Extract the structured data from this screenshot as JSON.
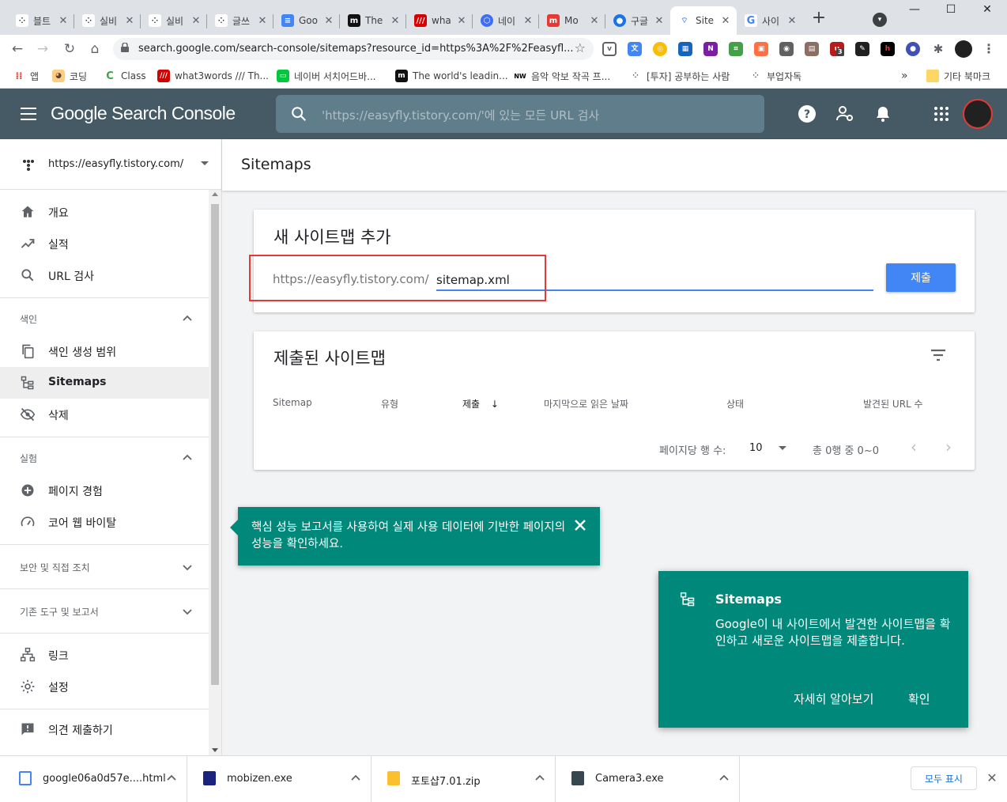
{
  "browser": {
    "tabs": [
      {
        "title": "블트",
        "active": false
      },
      {
        "title": "실비",
        "active": false
      },
      {
        "title": "실비",
        "active": false
      },
      {
        "title": "글쓰",
        "active": false
      },
      {
        "title": "Goo",
        "active": false
      },
      {
        "title": "The",
        "active": false
      },
      {
        "title": "wha",
        "active": false
      },
      {
        "title": "네이",
        "active": false
      },
      {
        "title": "Mo",
        "active": false
      },
      {
        "title": "구글",
        "active": false
      },
      {
        "title": "Site",
        "active": true
      },
      {
        "title": "사이",
        "active": false
      }
    ],
    "new_tab_symbol": "+",
    "url": "search.google.com/search-console/sitemaps?resource_id=https%3A%2F%2Feasyfl...",
    "ext_badge": "3",
    "bookmarks": [
      {
        "label": "앱"
      },
      {
        "label": "코딩"
      },
      {
        "label": "Class"
      },
      {
        "label": "what3words /// Th..."
      },
      {
        "label": "네이버 서치어드바..."
      },
      {
        "label": "The world's leadin..."
      },
      {
        "label": "음악 악보 작곡 프..."
      },
      {
        "label": "[투자] 공부하는 사람"
      },
      {
        "label": "부업자독"
      }
    ],
    "bookmarks_more": "»",
    "other_bookmarks": "기타 북마크"
  },
  "gsc": {
    "brand": "Google Search Console",
    "search_placeholder": "'https://easyfly.tistory.com/'에 있는 모든 URL 검사",
    "property": "https://easyfly.tistory.com/",
    "nav_top": [
      {
        "label": "개요",
        "icon": "home-icon"
      },
      {
        "label": "실적",
        "icon": "trending-up-icon"
      },
      {
        "label": "URL 검사",
        "icon": "search-icon"
      }
    ],
    "section_index": "색인",
    "nav_index": [
      {
        "label": "색인 생성 범위",
        "icon": "copy-icon"
      },
      {
        "label": "Sitemaps",
        "icon": "sitemap-icon"
      },
      {
        "label": "삭제",
        "icon": "visibility-off-icon"
      }
    ],
    "section_experience": "실험",
    "nav_experience": [
      {
        "label": "페이지 경험",
        "icon": "add-circle-icon"
      },
      {
        "label": "코어 웹 바이탈",
        "icon": "speed-icon"
      }
    ],
    "section_security": "보안 및 직접 조치",
    "section_legacy": "기존 도구 및 보고서",
    "nav_bottom": [
      {
        "label": "링크",
        "icon": "links-icon"
      },
      {
        "label": "설정",
        "icon": "settings-icon"
      }
    ],
    "feedback": "의견 제출하기"
  },
  "main": {
    "page_title": "Sitemaps",
    "add_card": {
      "title": "새 사이트맵 추가",
      "prefix": "https://easyfly.tistory.com/",
      "input_value": "sitemap.xml",
      "submit_label": "제출"
    },
    "submitted_card": {
      "title": "제출된 사이트맵",
      "columns": [
        "Sitemap",
        "유형",
        "제출",
        "마지막으로 읽은 날짜",
        "상태",
        "발견된 URL 수"
      ],
      "sort_arrow": "↓",
      "rows_per_page_label": "페이지당 행 수:",
      "rows_per_page_value": "10",
      "range_text": "총 0행 중 0~0",
      "prev_symbol": "‹",
      "next_symbol": "›"
    }
  },
  "tip": {
    "text": "핵심 성능 보고서를 사용하여 실제 사용 데이터에 기반한 페이지의 성능을 확인하세요."
  },
  "help_card": {
    "title": "Sitemaps",
    "body": "Google이 내 사이트에서 발견한 사이트맵을 확인하고 새로운 사이트맵을 제출합니다.",
    "learn_more": "자세히 알아보기",
    "ok": "확인"
  },
  "downloads": {
    "items": [
      {
        "name": "google06a0d57e....html"
      },
      {
        "name": "mobizen.exe"
      },
      {
        "name": "포토샵7.01.zip"
      },
      {
        "name": "Camera3.exe"
      }
    ],
    "show_all": "모두 표시"
  },
  "colors": {
    "header": "#455a64",
    "accent_blue": "#4285f4",
    "teal": "#00897b",
    "highlight_red": "#e53935"
  }
}
